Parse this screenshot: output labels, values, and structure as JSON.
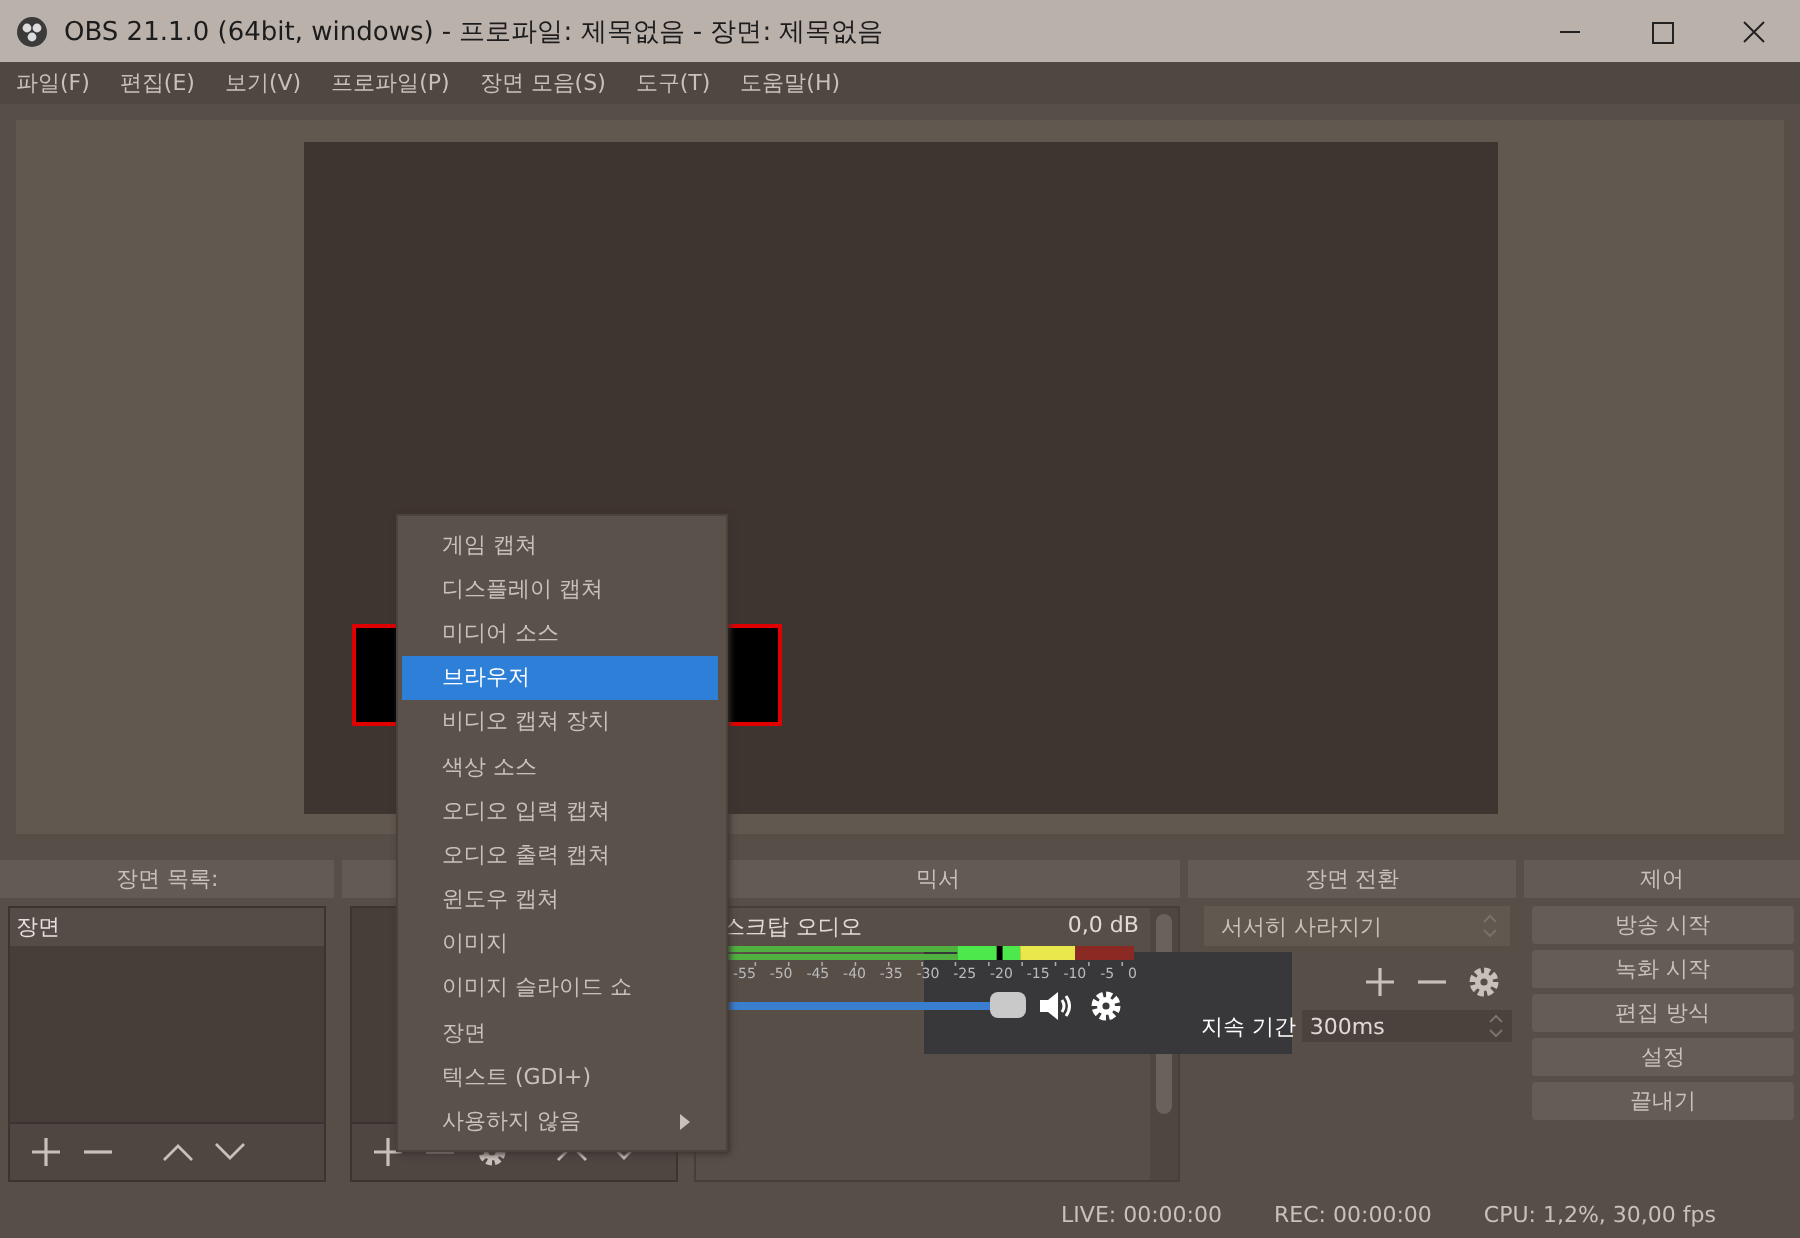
{
  "window": {
    "title": "OBS 21.1.0 (64bit, windows) - 프로파일: 제목없음 - 장면: 제목없음"
  },
  "menu_bar": [
    "파일(F)",
    "편집(E)",
    "보기(V)",
    "프로파일(P)",
    "장면 모음(S)",
    "도구(T)",
    "도움말(H)"
  ],
  "scenes": {
    "title": "장면 목록:",
    "items": [
      {
        "label": "장면",
        "selected": true
      }
    ]
  },
  "mixer": {
    "title": "믹서",
    "channels": [
      {
        "name": "스크탑 오디오",
        "reading": "0,0 dB",
        "level": 1,
        "muted": false
      }
    ],
    "scale": [
      "-55",
      "-50",
      "-45",
      "-40",
      "-35",
      "-30",
      "-25",
      "-20",
      "-15",
      "-10",
      "-5",
      "0"
    ]
  },
  "transitions": {
    "title": "장면 전환",
    "transition": "서서히 사라지기",
    "duration_label": "지속 기간",
    "duration": "300ms"
  },
  "controls": {
    "title": "제어",
    "buttons": [
      "방송 시작",
      "녹화 시작",
      "편집 방식",
      "설정",
      "끝내기"
    ]
  },
  "context_menu": {
    "items": [
      {
        "label": "게임 캡쳐",
        "selected": false,
        "submenu": false
      },
      {
        "label": "디스플레이 캡쳐",
        "selected": false,
        "submenu": false
      },
      {
        "label": "미디어 소스",
        "selected": false,
        "submenu": false
      },
      {
        "label": "브라우저",
        "selected": true,
        "submenu": false
      },
      {
        "label": "비디오 캡쳐 장치",
        "selected": false,
        "submenu": false
      },
      {
        "label": "색상 소스",
        "selected": false,
        "submenu": false
      },
      {
        "label": "오디오 입력 캡쳐",
        "selected": false,
        "submenu": false
      },
      {
        "label": "오디오 출력 캡쳐",
        "selected": false,
        "submenu": false
      },
      {
        "label": "윈도우 캡쳐",
        "selected": false,
        "submenu": false
      },
      {
        "label": "이미지",
        "selected": false,
        "submenu": false
      },
      {
        "label": "이미지 슬라이드 쇼",
        "selected": false,
        "submenu": false
      },
      {
        "label": "장면",
        "selected": false,
        "submenu": false
      },
      {
        "label": "텍스트 (GDI+)",
        "selected": false,
        "submenu": false
      },
      {
        "label": "사용하지 않음",
        "selected": false,
        "submenu": true
      }
    ]
  },
  "status_bar": [
    "LIVE: 00:00:00",
    "REC: 00:00:00",
    "CPU: 1,2%, 30,00 fps"
  ]
}
